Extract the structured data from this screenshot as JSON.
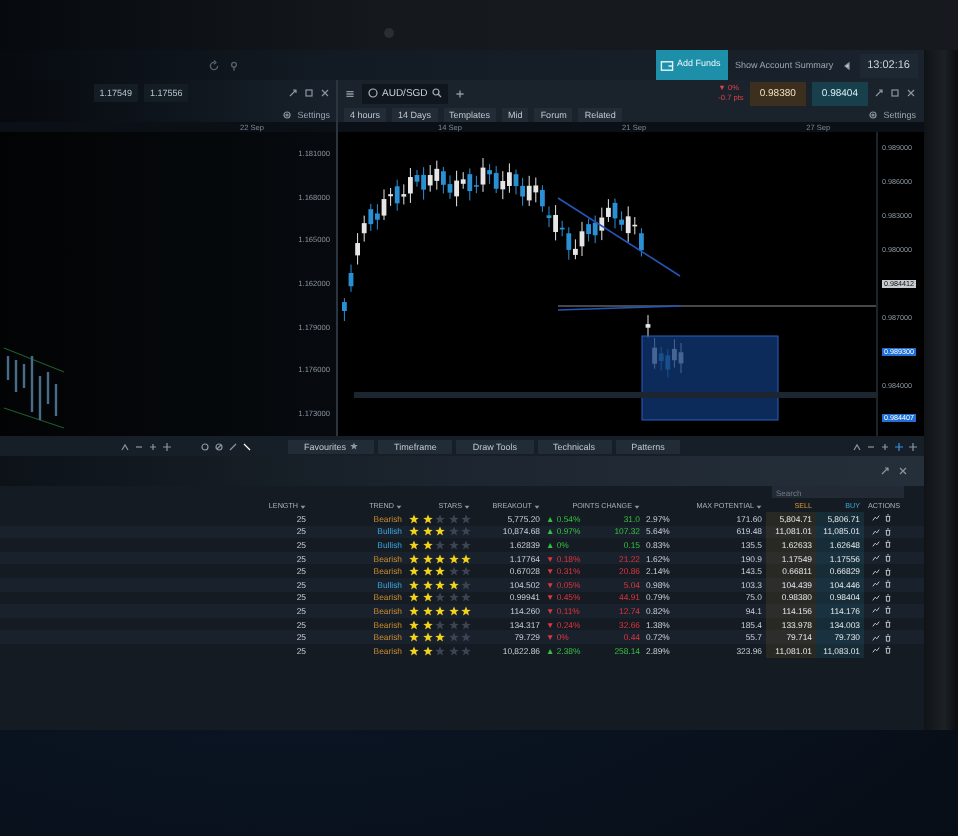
{
  "top_bar": {
    "add_funds": "Add Funds",
    "account_summary": "Show Account Summary",
    "clock": "13:02:16"
  },
  "side_window": {
    "prices": [
      "1.17549",
      "1.17556"
    ],
    "settings": "Settings",
    "date": "22 Sep",
    "price_labels": [
      "1.181000",
      "1.168000",
      "1.165000",
      "1.162000",
      "1.179000",
      "1.176000",
      "1.173000"
    ]
  },
  "chart_window": {
    "symbol": "AUD/SGD",
    "change_arrow": "▼",
    "change": "0%",
    "change_points": "-0.7 pts",
    "sell": "0.98380",
    "buy": "0.98404",
    "toolbar": [
      "4 hours",
      "14 Days",
      "Templates",
      "Mid",
      "Forum",
      "Related"
    ],
    "settings": "Settings",
    "dates": [
      "14 Sep",
      "21 Sep",
      "27 Sep"
    ],
    "price_labels": [
      {
        "text": "0.989000",
        "kind": "tick"
      },
      {
        "text": "0.986000",
        "kind": "tick"
      },
      {
        "text": "0.983000",
        "kind": "tick"
      },
      {
        "text": "0.980000",
        "kind": "tick"
      },
      {
        "text": "0.984412",
        "kind": "last"
      },
      {
        "text": "0.987000",
        "kind": "tick"
      },
      {
        "text": "0.989300",
        "kind": "order"
      },
      {
        "text": "0.984000",
        "kind": "tick"
      },
      {
        "text": "0.984407",
        "kind": "order"
      }
    ],
    "bottom_tools": [
      "Favourites",
      "Timeframe",
      "Draw Tools",
      "Technicals",
      "Patterns"
    ]
  },
  "scanner": {
    "search_placeholder": "Search",
    "columns": [
      {
        "label": "LENGTH",
        "kind": "sortable"
      },
      {
        "label": "TREND",
        "kind": "sortable"
      },
      {
        "label": "STARS",
        "kind": "sortable"
      },
      {
        "label": "BREAKOUT",
        "kind": "sortable"
      },
      {
        "label": "POINTS CHANGE",
        "kind": "sortable"
      },
      {
        "label": "MAX POTENTIAL",
        "kind": "sortable"
      },
      {
        "label": "SELL",
        "kind": "sell"
      },
      {
        "label": "BUY",
        "kind": "buy"
      },
      {
        "label": "ACTIONS",
        "kind": "plain"
      }
    ],
    "rows": [
      {
        "length": "25",
        "trend": "Bearish",
        "kind": "bearish",
        "stars": 2,
        "breakout": "5,775.20",
        "rising": true,
        "arrow": "▲",
        "change": "0.54%",
        "points": "31.0",
        "max_pct": "2.97%",
        "max_points": "171.60",
        "sell": "5,804.71",
        "buy": "5,806.71"
      },
      {
        "length": "25",
        "trend": "Bullish",
        "kind": "bullish",
        "stars": 3,
        "breakout": "10,874.68",
        "rising": true,
        "arrow": "▲",
        "change": "0.97%",
        "points": "107.32",
        "max_pct": "5.64%",
        "max_points": "619.48",
        "sell": "11,081.01",
        "buy": "11,085.01"
      },
      {
        "length": "25",
        "trend": "Bullish",
        "kind": "bullish",
        "stars": 2,
        "breakout": "1.62839",
        "rising": true,
        "arrow": "▲",
        "change": "0%",
        "points": "0.15",
        "max_pct": "0.83%",
        "max_points": "135.5",
        "sell": "1.62633",
        "buy": "1.62648"
      },
      {
        "length": "25",
        "trend": "Bearish",
        "kind": "bearish",
        "stars": 5,
        "breakout": "1.17764",
        "rising": false,
        "arrow": "▼",
        "change": "0.18%",
        "points": "21.22",
        "max_pct": "1.62%",
        "max_points": "190.9",
        "sell": "1.17549",
        "buy": "1.17556"
      },
      {
        "length": "25",
        "trend": "Bearish",
        "kind": "bearish",
        "stars": 3,
        "breakout": "0.67028",
        "rising": false,
        "arrow": "▼",
        "change": "0.31%",
        "points": "20.86",
        "max_pct": "2.14%",
        "max_points": "143.5",
        "sell": "0.66811",
        "buy": "0.66829"
      },
      {
        "length": "25",
        "trend": "Bullish",
        "kind": "bullish",
        "stars": 4,
        "breakout": "104.502",
        "rising": false,
        "arrow": "▼",
        "change": "0.05%",
        "points": "5.04",
        "max_pct": "0.98%",
        "max_points": "103.3",
        "sell": "104.439",
        "buy": "104.446"
      },
      {
        "length": "25",
        "trend": "Bearish",
        "kind": "bearish",
        "stars": 2,
        "breakout": "0.99941",
        "rising": false,
        "arrow": "▼",
        "change": "0.45%",
        "points": "44.91",
        "max_pct": "0.79%",
        "max_points": "75.0",
        "sell": "0.98380",
        "buy": "0.98404"
      },
      {
        "length": "25",
        "trend": "Bearish",
        "kind": "bearish",
        "stars": 5,
        "breakout": "114.260",
        "rising": false,
        "arrow": "▼",
        "change": "0.11%",
        "points": "12.74",
        "max_pct": "0.82%",
        "max_points": "94.1",
        "sell": "114.156",
        "buy": "114.176"
      },
      {
        "length": "25",
        "trend": "Bearish",
        "kind": "bearish",
        "stars": 2,
        "breakout": "134.317",
        "rising": false,
        "arrow": "▼",
        "change": "0.24%",
        "points": "32.66",
        "max_pct": "1.38%",
        "max_points": "185.4",
        "sell": "133.978",
        "buy": "134.003"
      },
      {
        "length": "25",
        "trend": "Bearish",
        "kind": "bearish",
        "stars": 3,
        "breakout": "79.729",
        "rising": false,
        "arrow": "▼",
        "change": "0%",
        "points": "0.44",
        "max_pct": "0.72%",
        "max_points": "55.7",
        "sell": "79.714",
        "buy": "79.730"
      },
      {
        "length": "25",
        "trend": "Bearish",
        "kind": "bearish",
        "stars": 2,
        "breakout": "10,822.86",
        "rising": true,
        "arrow": "▲",
        "change": "2.38%",
        "points": "258.14",
        "max_pct": "2.89%",
        "max_points": "323.96",
        "sell": "11,081.01",
        "buy": "11,083.01"
      }
    ]
  }
}
